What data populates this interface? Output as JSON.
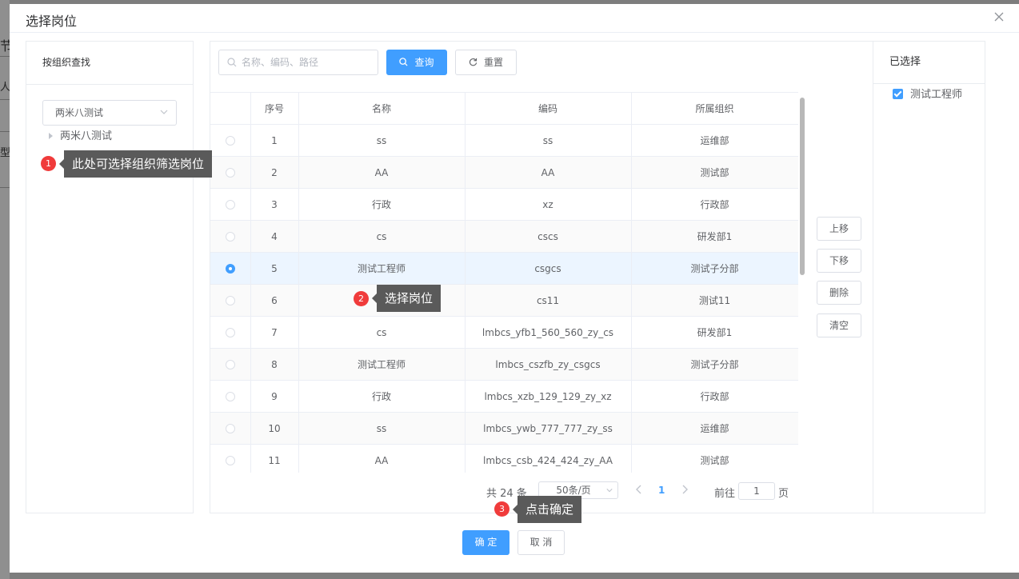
{
  "background": {
    "glyphs": [
      "节",
      "人",
      "型"
    ]
  },
  "dialog": {
    "title": "选择岗位"
  },
  "left": {
    "header": "按组织查找",
    "org_select": "两米八测试",
    "tree_node": "两米八测试"
  },
  "search": {
    "placeholder": "名称、编码、路径",
    "query_label": "查询",
    "reset_label": "重置"
  },
  "table": {
    "columns": [
      "序号",
      "名称",
      "编码",
      "所属组织"
    ],
    "rows": [
      {
        "no": "1",
        "name": "ss",
        "code": "ss",
        "org": "运维部",
        "selected": false
      },
      {
        "no": "2",
        "name": "AA",
        "code": "AA",
        "org": "测试部",
        "selected": false
      },
      {
        "no": "3",
        "name": "行政",
        "code": "xz",
        "org": "行政部",
        "selected": false
      },
      {
        "no": "4",
        "name": "cs",
        "code": "cscs",
        "org": "研发部1",
        "selected": false
      },
      {
        "no": "5",
        "name": "测试工程师",
        "code": "csgcs",
        "org": "测试子分部",
        "selected": true
      },
      {
        "no": "6",
        "name": "",
        "code": "cs11",
        "org": "测试11",
        "selected": false
      },
      {
        "no": "7",
        "name": "cs",
        "code": "lmbcs_yfb1_560_560_zy_cs",
        "org": "研发部1",
        "selected": false
      },
      {
        "no": "8",
        "name": "测试工程师",
        "code": "lmbcs_cszfb_zy_csgcs",
        "org": "测试子分部",
        "selected": false
      },
      {
        "no": "9",
        "name": "行政",
        "code": "lmbcs_xzb_129_129_zy_xz",
        "org": "行政部",
        "selected": false
      },
      {
        "no": "10",
        "name": "ss",
        "code": "lmbcs_ywb_777_777_zy_ss",
        "org": "运维部",
        "selected": false
      },
      {
        "no": "11",
        "name": "AA",
        "code": "lmbcs_csb_424_424_zy_AA",
        "org": "测试部",
        "selected": false
      }
    ]
  },
  "pagination": {
    "total": "共 24 条",
    "page_size": "50条/页",
    "current_page": "1",
    "goto_label": "前往",
    "goto_value": "1",
    "page_unit": "页"
  },
  "actions": {
    "up": "上移",
    "down": "下移",
    "delete": "删除",
    "clear": "清空"
  },
  "selected_panel": {
    "header": "已选择",
    "items": [
      "测试工程师"
    ]
  },
  "footer": {
    "ok": "确 定",
    "cancel": "取 消"
  },
  "tips": [
    {
      "num": "1",
      "text": "此处可选择组织筛选岗位"
    },
    {
      "num": "2",
      "text": "选择岗位"
    },
    {
      "num": "3",
      "text": "点击确定"
    }
  ],
  "colors": {
    "primary": "#409eff",
    "tip_dot": "#f03b3b",
    "tip_bg": "#5a5a5a",
    "row_highlight": "#ecf5ff"
  }
}
